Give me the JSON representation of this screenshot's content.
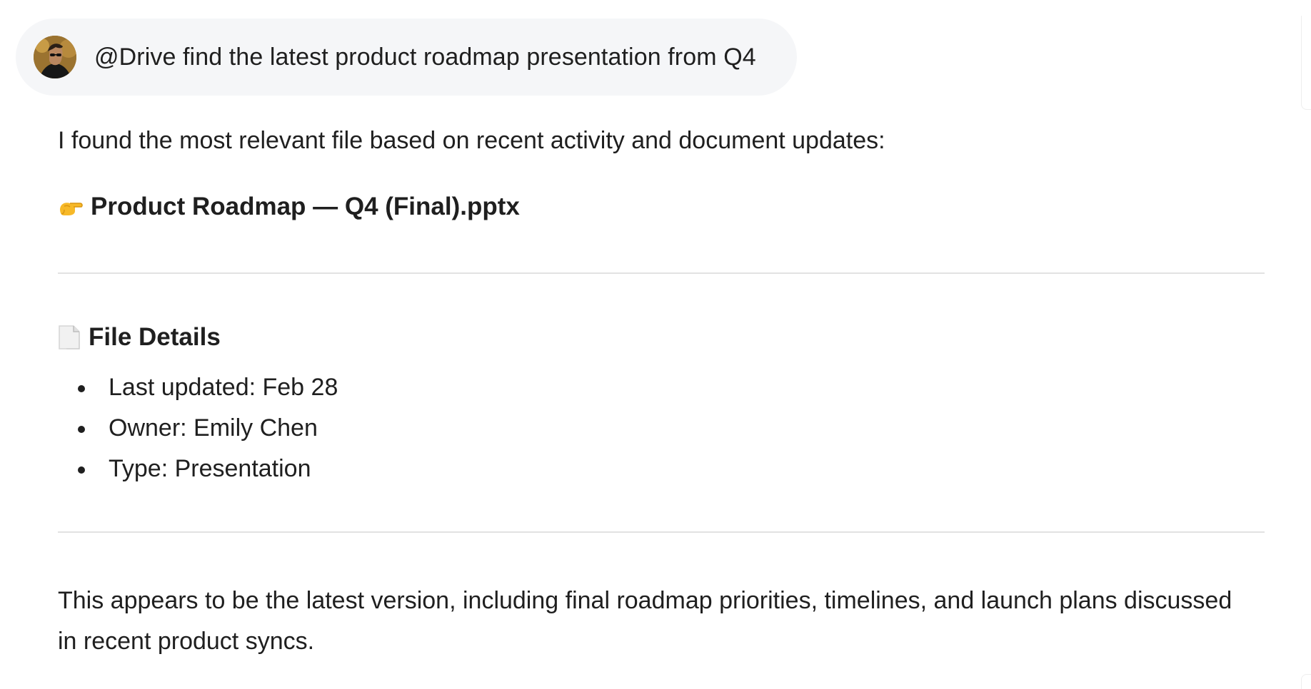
{
  "user_message": {
    "avatar": "user-avatar",
    "text": "@Drive find the latest product roadmap presentation from Q4"
  },
  "assistant": {
    "intro": "I found the most relevant file based on recent activity and document updates:",
    "file_icon": "pointing-hand-icon",
    "file_name": "Product Roadmap — Q4 (Final).pptx",
    "details_icon": "page-icon",
    "details_title": "File Details",
    "details": [
      "Last updated: Feb 28",
      "Owner: Emily Chen",
      "Type: Presentation"
    ],
    "summary": "This appears to be the latest version, including final roadmap priorities, timelines, and launch plans discussed in recent product syncs."
  },
  "colors": {
    "bubble_background": "#f5f6f8",
    "text": "#1f1f1f",
    "divider": "#e2e2e2"
  }
}
